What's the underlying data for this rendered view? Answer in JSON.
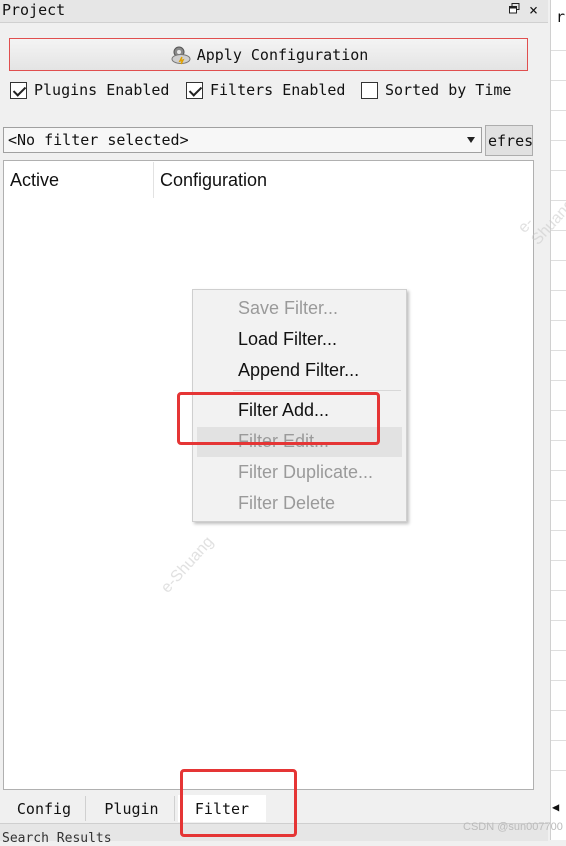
{
  "panel": {
    "title": "Project",
    "float_icon": "float-window-icon",
    "close_icon": "close-icon"
  },
  "toolbar": {
    "apply_label": "Apply Configuration",
    "apply_icon": "gear-cloud-icon",
    "apply_border_color": "#e04f4f"
  },
  "options": [
    {
      "label": "Plugins Enabled",
      "checked": true
    },
    {
      "label": "Filters Enabled",
      "checked": true
    },
    {
      "label": "Sorted by Time",
      "checked": false
    }
  ],
  "filter_select": {
    "value": "<No filter selected>",
    "refresh_label": "efres"
  },
  "table": {
    "columns": [
      "Active",
      "Configuration"
    ]
  },
  "context_menu": {
    "items": [
      {
        "label": "Save Filter...",
        "enabled": false
      },
      {
        "label": "Load Filter...",
        "enabled": true
      },
      {
        "label": "Append Filter...",
        "enabled": true
      },
      {
        "label": "Filter Add...",
        "enabled": true
      },
      {
        "label": "Filter Edit...",
        "enabled": false
      },
      {
        "label": "Filter Duplicate...",
        "enabled": false
      },
      {
        "label": "Filter Delete",
        "enabled": false
      }
    ],
    "highlight_color": "#e53535"
  },
  "tabs": [
    {
      "label": "Config",
      "active": false
    },
    {
      "label": "Plugin",
      "active": false
    },
    {
      "label": "Filter",
      "active": true
    }
  ],
  "bottom_panel": {
    "title": "Search Results"
  },
  "right_panel": {
    "fragment": "r"
  },
  "watermarks": {
    "text": "e-Shuang",
    "credit": "CSDN @sun007700"
  }
}
